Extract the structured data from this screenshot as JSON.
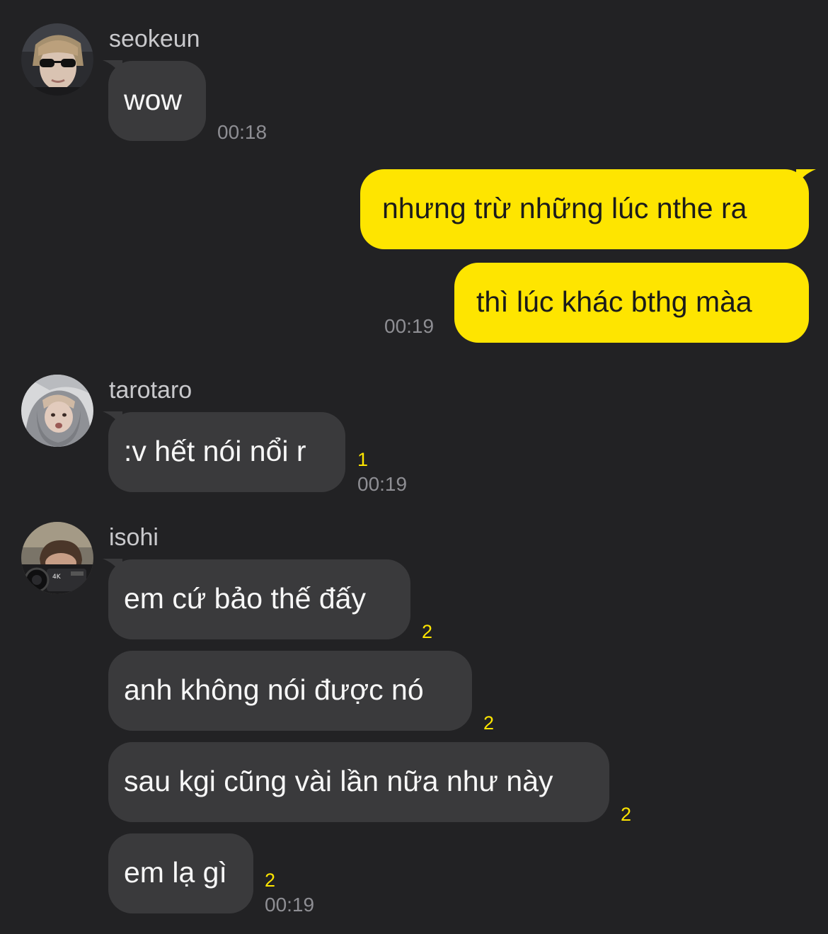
{
  "colors": {
    "background": "#222224",
    "incoming_bubble": "#3a3a3c",
    "outgoing_bubble": "#fee500",
    "unread_count": "#fee500",
    "timestamp": "#8e8e93"
  },
  "groups": [
    {
      "sender": "seokeun",
      "avatar": "avatar-sunglasses",
      "messages": [
        {
          "text": "wow",
          "unread": "",
          "time": "00:18"
        }
      ]
    },
    {
      "sender": "me",
      "messages": [
        {
          "text": "nhưng trừ những lúc nthe ra",
          "time": ""
        },
        {
          "text": "thì lúc khác bthg màa",
          "time": "00:19"
        }
      ]
    },
    {
      "sender": "tarotaro",
      "avatar": "avatar-hoodie",
      "messages": [
        {
          "text": ":v hết nói nổi r",
          "unread": "1",
          "time": "00:19"
        }
      ]
    },
    {
      "sender": "isohi",
      "avatar": "avatar-camera",
      "messages": [
        {
          "text": "em cứ bảo thế đấy",
          "unread": "2",
          "time": ""
        },
        {
          "text": "anh không nói được nó",
          "unread": "2",
          "time": ""
        },
        {
          "text": "sau kgi cũng vài lần nữa như này",
          "unread": "2",
          "time": ""
        },
        {
          "text": "em lạ gì",
          "unread": "2",
          "time": "00:19"
        }
      ]
    }
  ]
}
